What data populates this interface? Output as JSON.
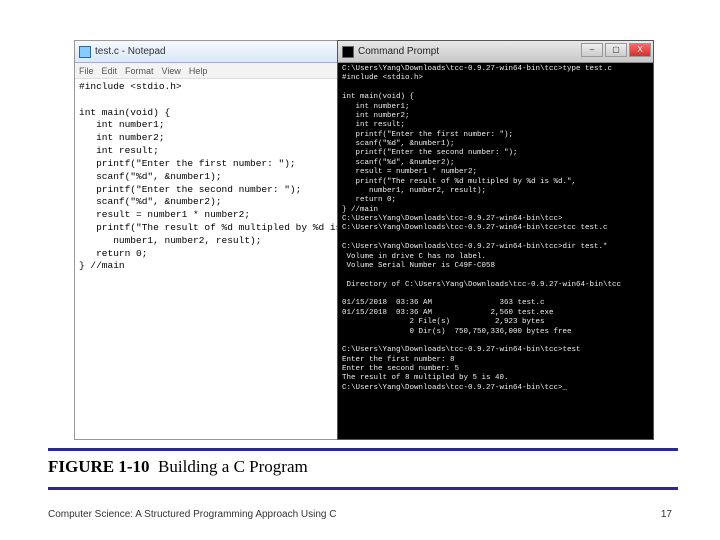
{
  "notepad": {
    "title": "test.c - Notepad",
    "menu": [
      "File",
      "Edit",
      "Format",
      "View",
      "Help"
    ],
    "code": "#include <stdio.h>\n\nint main(void) {\n   int number1;\n   int number2;\n   int result;\n   printf(\"Enter the first number: \");\n   scanf(\"%d\", &number1);\n   printf(\"Enter the second number: \");\n   scanf(\"%d\", &number2);\n   result = number1 * number2;\n   printf(\"The result of %d multipled by %d is %d.\",\n      number1, number2, result);\n   return 0;\n} //main"
  },
  "cmd": {
    "title": "Command Prompt",
    "output": "C:\\Users\\Yang\\Downloads\\tcc-0.9.27-win64-bin\\tcc>type test.c\n#include <stdio.h>\n\nint main(void) {\n   int number1;\n   int number2;\n   int result;\n   printf(\"Enter the first number: \");\n   scanf(\"%d\", &number1);\n   printf(\"Enter the second number: \");\n   scanf(\"%d\", &number2);\n   result = number1 * number2;\n   printf(\"The result of %d multipled by %d is %d.\",\n      number1, number2, result);\n   return 0;\n} //main\nC:\\Users\\Yang\\Downloads\\tcc-0.9.27-win64-bin\\tcc>\nC:\\Users\\Yang\\Downloads\\tcc-0.9.27-win64-bin\\tcc>tcc test.c\n\nC:\\Users\\Yang\\Downloads\\tcc-0.9.27-win64-bin\\tcc>dir test.*\n Volume in drive C has no label.\n Volume Serial Number is C49F-C058\n\n Directory of C:\\Users\\Yang\\Downloads\\tcc-0.9.27-win64-bin\\tcc\n\n01/15/2018  03:36 AM               363 test.c\n01/15/2018  03:36 AM             2,560 test.exe\n               2 File(s)          2,923 bytes\n               0 Dir(s)  750,750,336,000 bytes free\n\nC:\\Users\\Yang\\Downloads\\tcc-0.9.27-win64-bin\\tcc>test\nEnter the first number: 8\nEnter the second number: 5\nThe result of 8 multipled by 5 is 40.\nC:\\Users\\Yang\\Downloads\\tcc-0.9.27-win64-bin\\tcc>_"
  },
  "figure": {
    "label": "FIGURE 1-10",
    "text": "Building a C Program"
  },
  "footer": {
    "left": "Computer Science: A Structured Programming Approach Using C",
    "right": "17"
  }
}
